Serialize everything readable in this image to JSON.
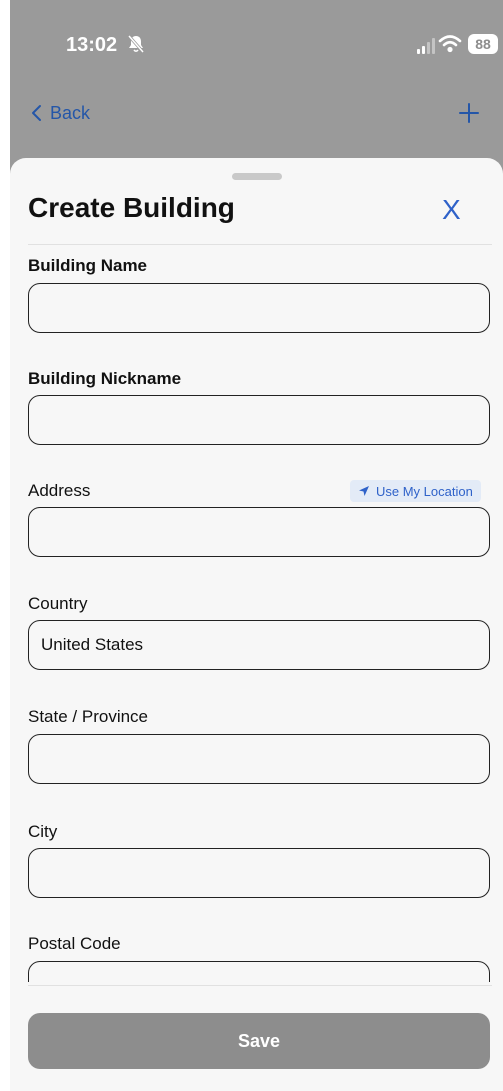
{
  "status_bar": {
    "time": "13:02",
    "battery": "88"
  },
  "nav": {
    "back_label": "Back"
  },
  "sheet": {
    "title": "Create Building",
    "close_label": "X",
    "fields": {
      "building_name": {
        "label": "Building Name",
        "value": ""
      },
      "building_nickname": {
        "label": "Building Nickname",
        "value": ""
      },
      "address": {
        "label": "Address",
        "value": "",
        "location_button": "Use My Location"
      },
      "country": {
        "label": "Country",
        "value": "United States"
      },
      "state": {
        "label": "State / Province",
        "value": ""
      },
      "city": {
        "label": "City",
        "value": ""
      },
      "postal_code": {
        "label": "Postal Code",
        "value": ""
      }
    },
    "save_label": "Save"
  },
  "colors": {
    "accent": "#2f62c9",
    "save_disabled": "#8d8d8d",
    "sheet_bg": "#f7f7f7",
    "backdrop": "#9a9a9a"
  }
}
